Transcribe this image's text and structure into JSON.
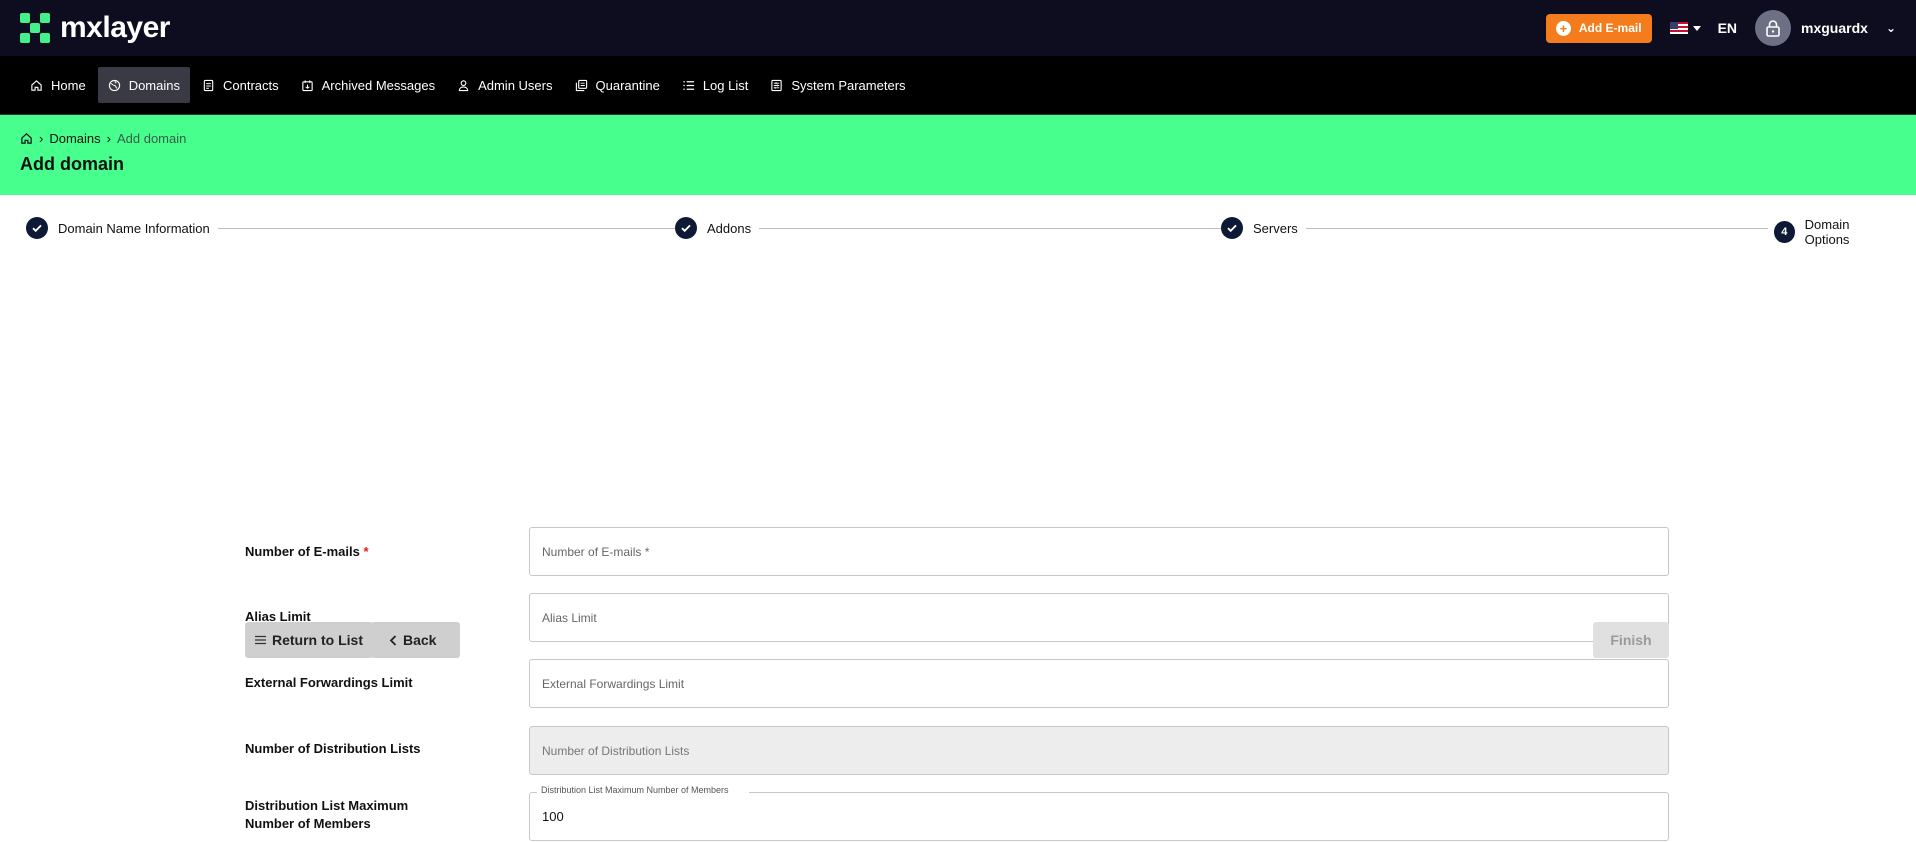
{
  "app": {
    "logo_text": "mxlayer"
  },
  "topbar": {
    "add_email_label": "Add E-mail",
    "language": "EN",
    "username": "mxguardx"
  },
  "nav": {
    "items": [
      {
        "label": "Home",
        "icon": "home-icon",
        "active": false
      },
      {
        "label": "Domains",
        "icon": "globe-icon",
        "active": true
      },
      {
        "label": "Contracts",
        "icon": "document-icon",
        "active": false
      },
      {
        "label": "Archived Messages",
        "icon": "archive-icon",
        "active": false
      },
      {
        "label": "Admin Users",
        "icon": "user-icon",
        "active": false
      },
      {
        "label": "Quarantine",
        "icon": "quarantine-icon",
        "active": false
      },
      {
        "label": "Log List",
        "icon": "list-icon",
        "active": false
      },
      {
        "label": "System Parameters",
        "icon": "settings-doc-icon",
        "active": false
      }
    ]
  },
  "breadcrumb": {
    "home_icon": "home-icon",
    "parent": "Domains",
    "current": "Add domain"
  },
  "page_title": "Add domain",
  "stepper": {
    "steps": [
      {
        "label": "Domain Name Information",
        "state": "done"
      },
      {
        "label": "Addons",
        "state": "done"
      },
      {
        "label": "Servers",
        "state": "done"
      },
      {
        "label": "Domain Options",
        "state": "current",
        "number": "4"
      }
    ]
  },
  "form": {
    "emails": {
      "label": "Number of E-mails",
      "required": "*",
      "placeholder": "Number of E-mails *"
    },
    "alias": {
      "label": "Alias Limit",
      "placeholder": "Alias Limit"
    },
    "forwardings": {
      "label": "External Forwardings Limit",
      "placeholder": "External Forwardings Limit"
    },
    "dist_lists": {
      "label": "Number of Distribution Lists",
      "placeholder": "Number of Distribution Lists"
    },
    "dist_members": {
      "label_line1": "Distribution List Maximum",
      "label_line2": "Number of Members",
      "floating_label": "Distribution List Maximum Number of Members",
      "value": "100"
    }
  },
  "actions": {
    "return_label": "Return to List",
    "back_label": "Back",
    "finish_label": "Finish"
  },
  "colors": {
    "accent_green": "#46ff8c",
    "add_email_orange": "#f47c1c",
    "topbar_bg": "#0e0d1f",
    "step_circle": "#0e1a35"
  }
}
